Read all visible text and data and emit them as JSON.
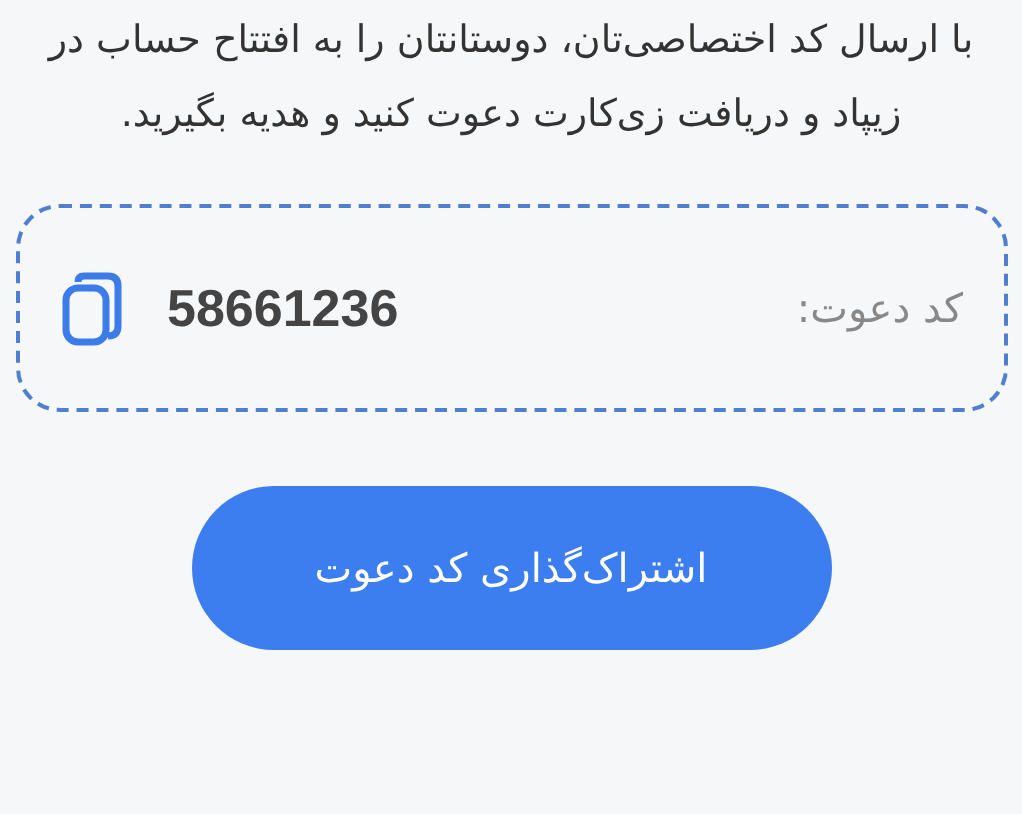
{
  "description": "با ارسال کد اختصاصی‌تان، دوستانتان را به افتتاح حساب در زیپاد و دریافت زی‌کارت دعوت کنید و هدیه بگیرید.",
  "invite": {
    "label": "کد دعوت:",
    "code": "58661236"
  },
  "share_button": "اشتراک‌گذاری کد دعوت"
}
